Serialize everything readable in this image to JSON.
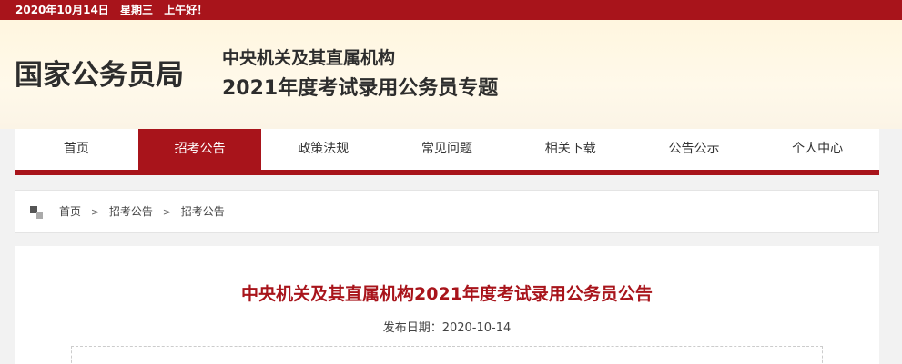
{
  "topbar": {
    "date": "2020年10月14日",
    "weekday": "星期三",
    "greeting": "上午好！"
  },
  "header": {
    "logo": "国家公务员局",
    "subtitle_line1": "中央机关及其直属机构",
    "subtitle_line2": "2021年度考试录用公务员专题"
  },
  "nav": {
    "items": [
      {
        "label": "首页"
      },
      {
        "label": "招考公告"
      },
      {
        "label": "政策法规"
      },
      {
        "label": "常见问题"
      },
      {
        "label": "相关下载"
      },
      {
        "label": "公告公示"
      },
      {
        "label": "个人中心"
      }
    ],
    "active_index": 1
  },
  "breadcrumb": {
    "items": [
      "首页",
      "招考公告",
      "招考公告"
    ],
    "separator": ">"
  },
  "article": {
    "title": "中央机关及其直属机构2021年度考试录用公务员公告",
    "publish_date": "发布日期：2020-10-14"
  },
  "colors": {
    "brand_red": "#a8141b",
    "banner_bg": "#fff6df"
  },
  "icons": {
    "breadcrumb": "location-squares-icon"
  }
}
